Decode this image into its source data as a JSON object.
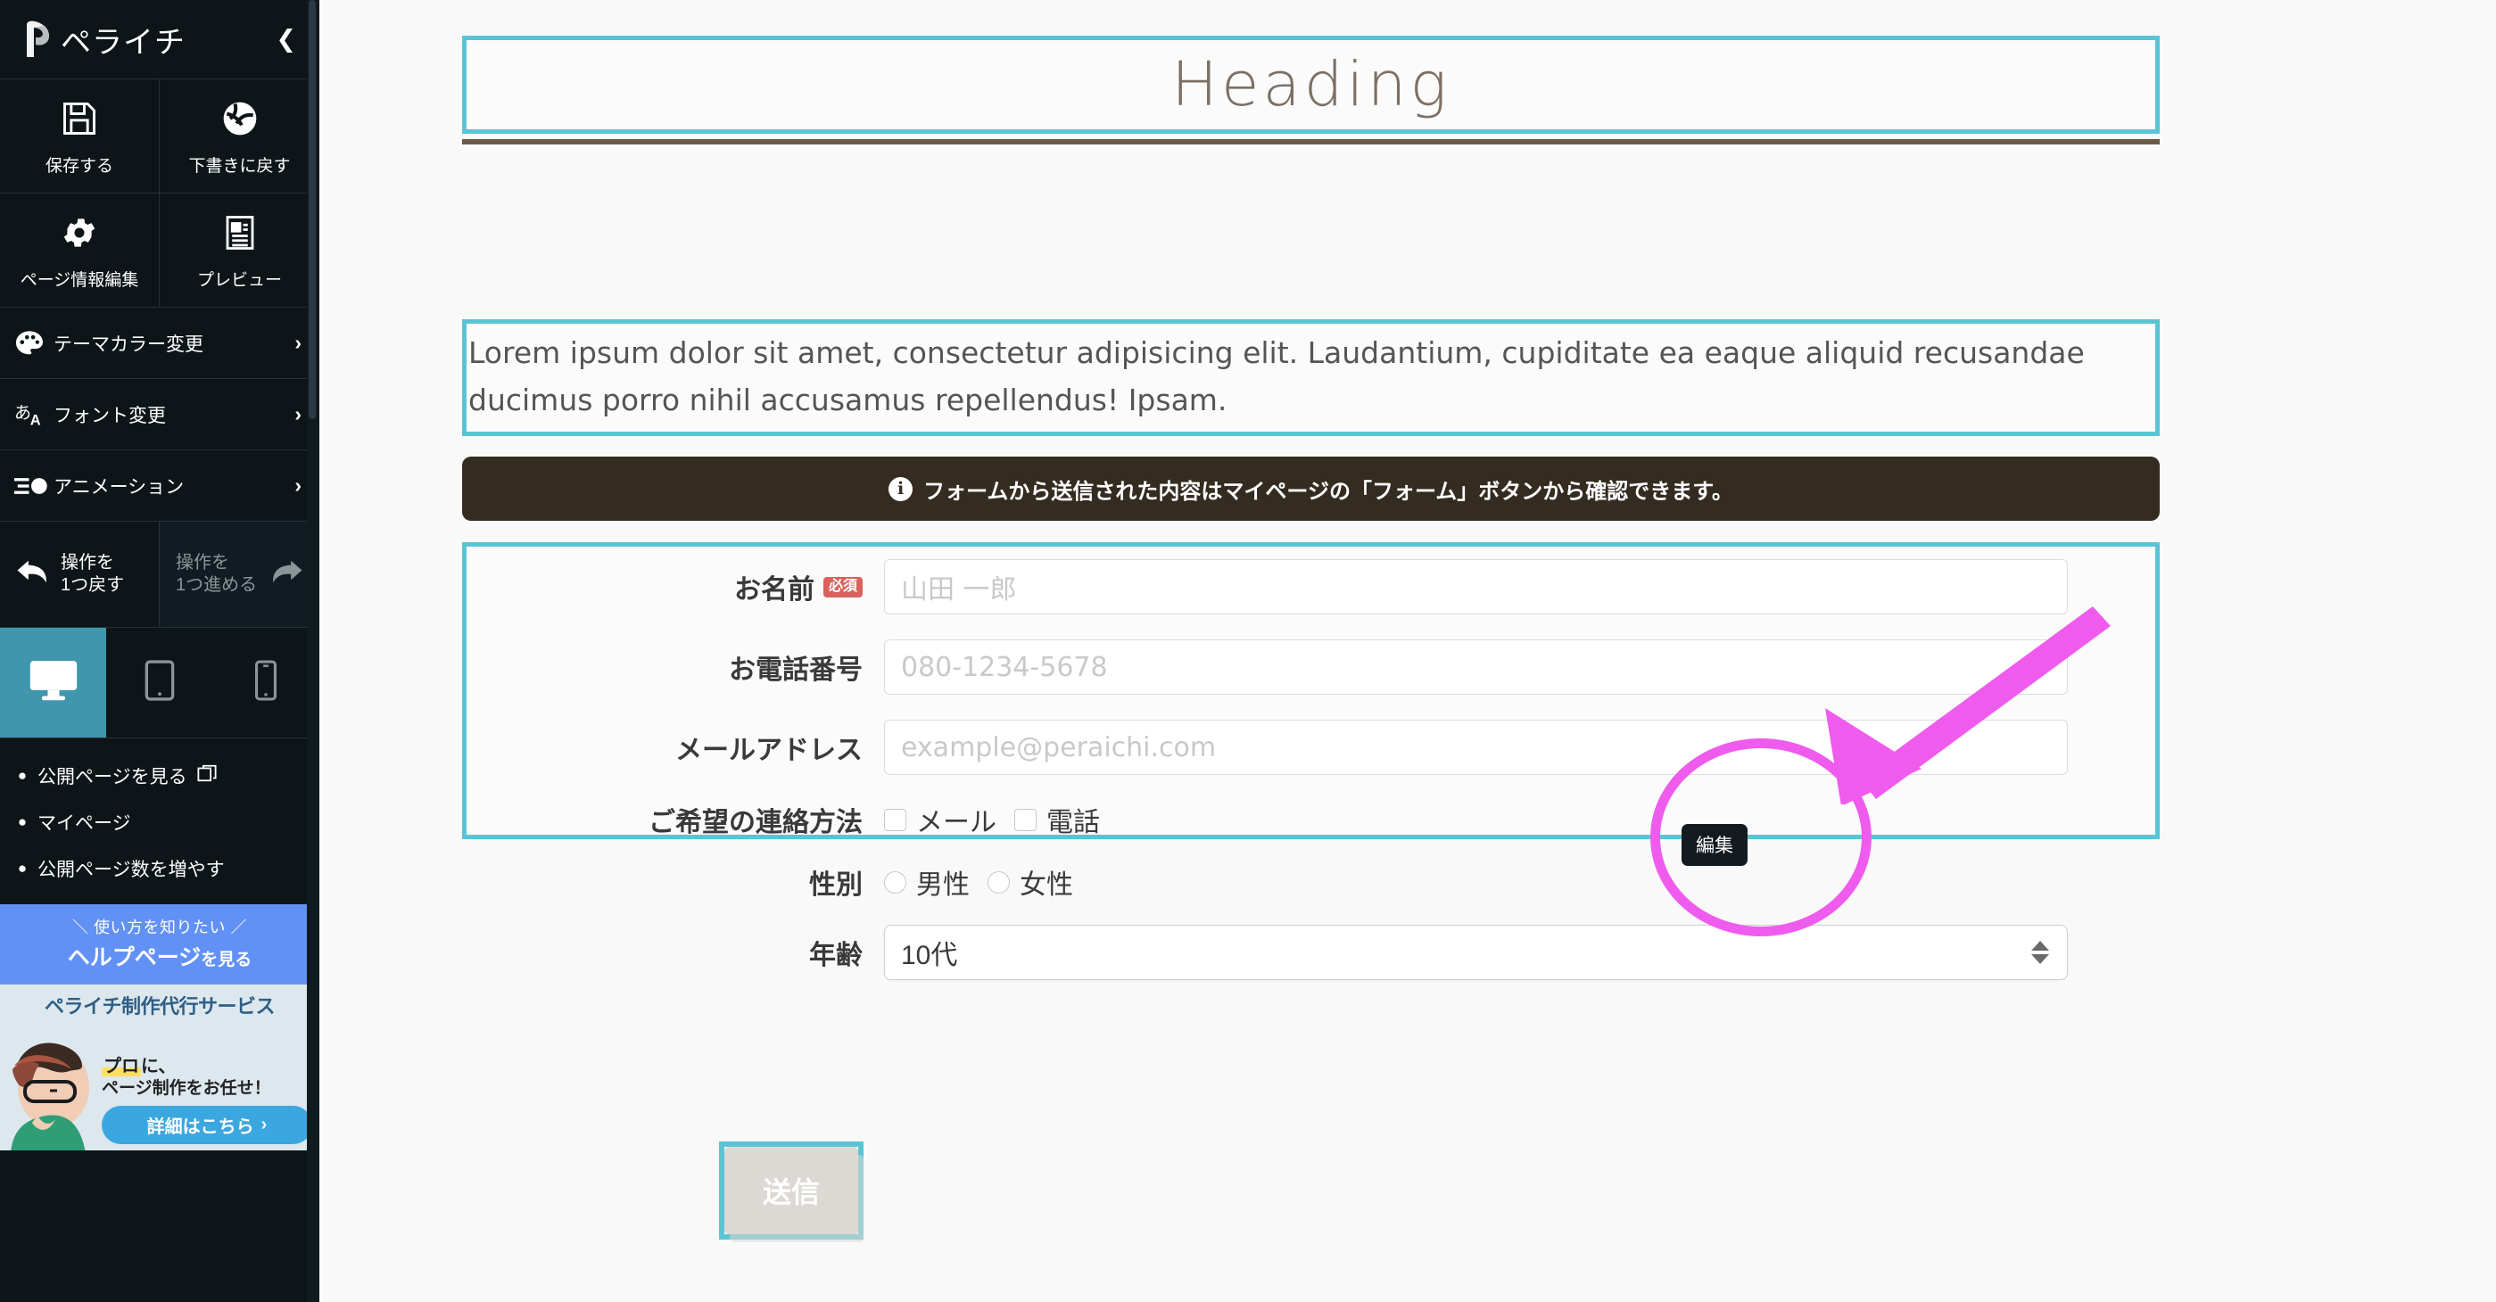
{
  "sidebar": {
    "brand": "ペライチ",
    "collapse_icon": "chevron-left-icon",
    "actions": [
      {
        "icon": "save-floppy-icon",
        "label": "保存する"
      },
      {
        "icon": "revert-globe-icon",
        "label": "下書きに戻す"
      },
      {
        "icon": "gear-icon",
        "label": "ページ情報編集"
      },
      {
        "icon": "preview-document-icon",
        "label": "プレビュー"
      }
    ],
    "menu": [
      {
        "icon": "palette-icon",
        "label": "テーマカラー変更",
        "chevron": "›"
      },
      {
        "icon": "font-icon",
        "label": "フォント変更",
        "chevron": "›"
      },
      {
        "icon": "animation-icon",
        "label": "アニメーション",
        "chevron": "›"
      }
    ],
    "history": {
      "undo_label": "操作を\n1つ戻す",
      "redo_label": "操作を\n1つ進める",
      "undo_icon": "undo-arrow-icon",
      "redo_icon": "redo-arrow-icon"
    },
    "devices": [
      {
        "name": "desktop-icon",
        "active": true
      },
      {
        "name": "tablet-icon",
        "active": false
      },
      {
        "name": "mobile-icon",
        "active": false
      }
    ],
    "links": [
      {
        "label": "公開ページを見る",
        "external": true
      },
      {
        "label": "マイページ",
        "external": false
      },
      {
        "label": "公開ページ数を増やす",
        "external": false
      }
    ],
    "help": {
      "small": "＼ 使い方を知りたい ／",
      "big": "ヘルプページ",
      "tail": "を見る"
    },
    "promo": {
      "title": "ペライチ制作代行サービス",
      "line1_strong": "プロ",
      "line1_rest": "に、",
      "line2": "ページ制作をお任せ！",
      "button": "詳細はこちら",
      "button_chevron": "›"
    },
    "accent_active": "#3f96ad",
    "help_bg": "#6291f5"
  },
  "canvas": {
    "heading": "Heading",
    "paragraph": "Lorem ipsum dolor sit amet, consectetur adipisicing elit. Laudantium, cupiditate ea eaque aliquid recusandae ducimus porro nihil accusamus repellendus! Ipsam.",
    "notice": "フォームから送信された内容はマイページの「フォーム」ボタンから確認できます。",
    "form": {
      "fields": [
        {
          "label": "お名前",
          "required_badge": "必須",
          "type": "text",
          "placeholder": "山田 一郎"
        },
        {
          "label": "お電話番号",
          "required_badge": "",
          "type": "text",
          "placeholder": "080-1234-5678"
        },
        {
          "label": "メールアドレス",
          "required_badge": "",
          "type": "text",
          "placeholder": "example@peraichi.com"
        }
      ],
      "contact_method": {
        "label": "ご希望の連絡方法",
        "options": [
          "メール",
          "電話"
        ]
      },
      "gender": {
        "label": "性別",
        "options": [
          "男性",
          "女性"
        ]
      },
      "age": {
        "label": "年齢",
        "selected": "10代"
      }
    },
    "submit_label": "送信",
    "selection_color": "#5bc4d4",
    "heading_color": "#7d6f63",
    "notice_bg": "#352c21"
  },
  "annotations": {
    "tooltip": "編集",
    "highlight_color": "#ef5ced"
  }
}
